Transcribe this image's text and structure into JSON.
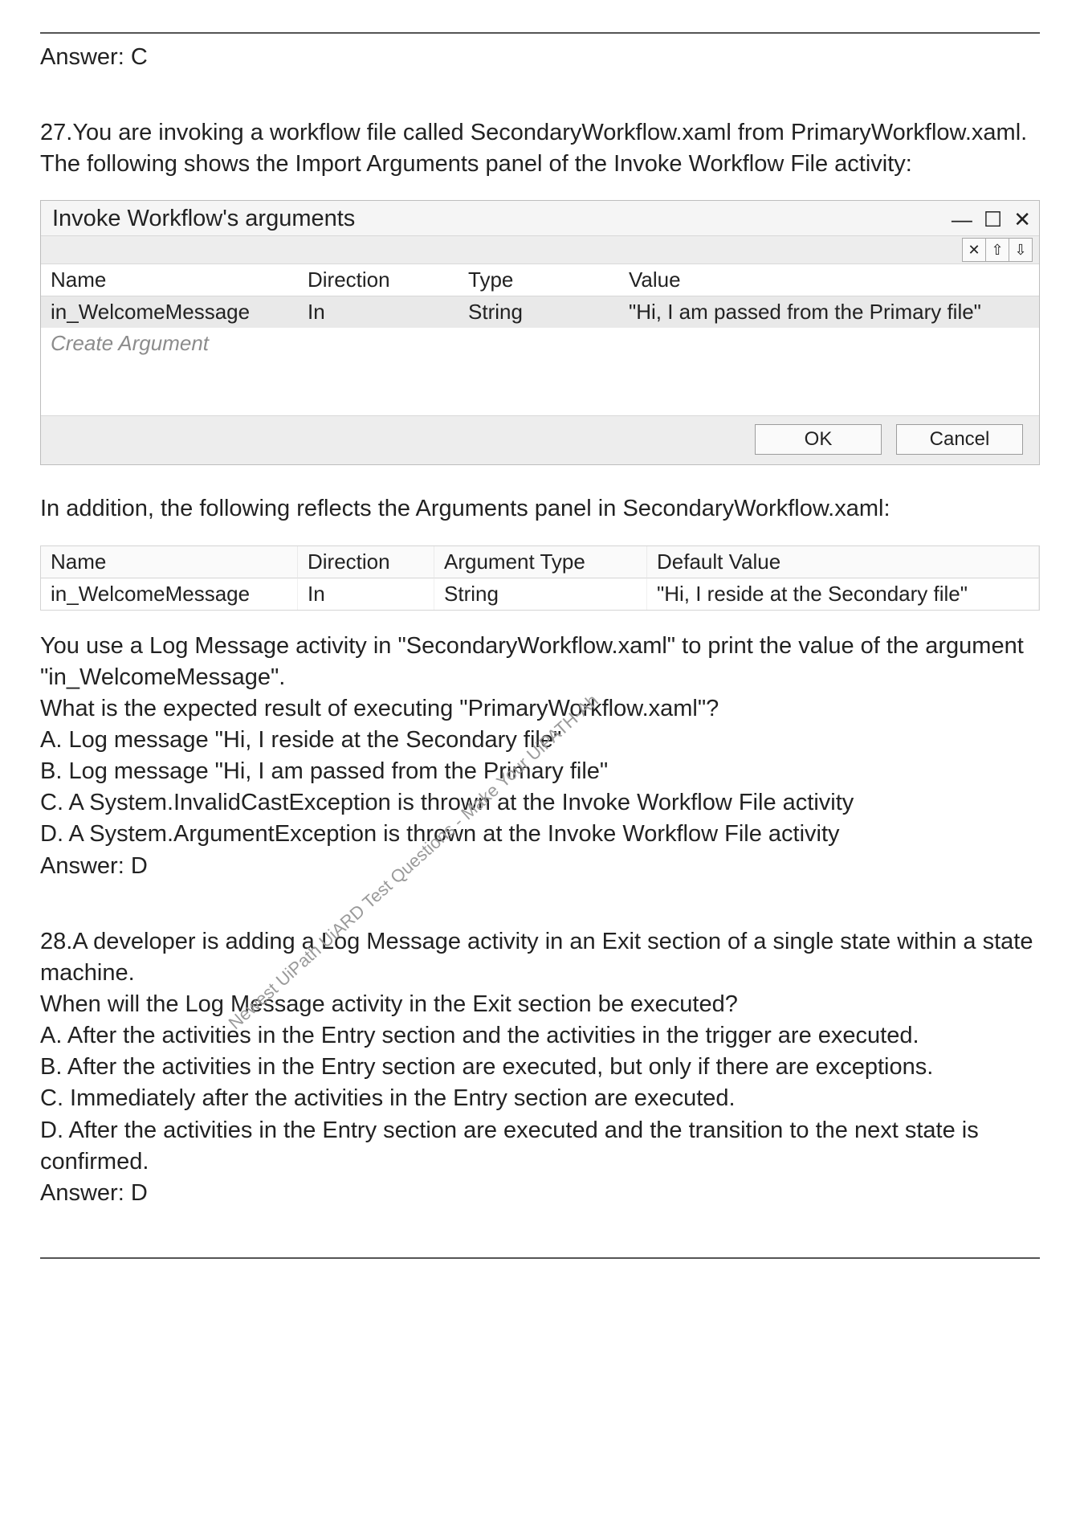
{
  "top_answer": "Answer: C",
  "q27": {
    "intro_line1": "27.You are invoking a workflow file called SecondaryWorkflow.xaml from PrimaryWorkflow.xaml.",
    "intro_line2": "The following shows the Import Arguments panel of the Invoke Workflow File activity:",
    "dialog": {
      "title": "Invoke Workflow's arguments",
      "minimize": "—",
      "maximize": "☐",
      "close": "✕",
      "tool_delete": "✕",
      "tool_up": "⇧",
      "tool_down": "⇩",
      "headers": {
        "name": "Name",
        "direction": "Direction",
        "type": "Type",
        "value": "Value"
      },
      "row": {
        "name": "in_WelcomeMessage",
        "direction": "In",
        "type": "String",
        "value": "\"Hi, I am passed from the Primary file\""
      },
      "create": "Create Argument",
      "ok": "OK",
      "cancel": "Cancel"
    },
    "mid_line": "In addition, the following reflects the Arguments panel in SecondaryWorkflow.xaml:",
    "args_panel": {
      "headers": {
        "name": "Name",
        "direction": "Direction",
        "argtype": "Argument Type",
        "default": "Default Value"
      },
      "row": {
        "name": "in_WelcomeMessage",
        "direction": "In",
        "argtype": "String",
        "default": "\"Hi, I reside at the Secondary file\""
      }
    },
    "post_line1": "You use a Log Message activity in \"SecondaryWorkflow.xaml\" to print the value of the argument \"in_WelcomeMessage\".",
    "post_line2": "What is the expected result of executing \"PrimaryWorkflow.xaml\"?",
    "opt_a": "A. Log message \"Hi, I reside at the Secondary file\"",
    "opt_b": "B. Log message \"Hi, I am passed from the Primary file\"",
    "opt_c": "C. A System.InvalidCastException is thrown at the Invoke Workflow File activity",
    "opt_d": "D. A System.ArgumentException is thrown at the Invoke Workflow File activity",
    "answer": "Answer: D"
  },
  "q28": {
    "intro": "28.A developer is adding a Log Message activity in an Exit section of a single state within a state machine.",
    "q": "When will the Log Message activity in the Exit section be executed?",
    "opt_a": "A. After the activities in the Entry section and the activities in the trigger are executed.",
    "opt_b": "B. After the activities in the Entry section are executed, but only if there are exceptions.",
    "opt_c": "C. Immediately after the activities in the Entry section are executed.",
    "opt_d": "D. After the activities in the Entry section are executed and the transition to the next state is confirmed.",
    "answer": "Answer: D"
  },
  "watermark": "Newest UiPath UiARD Test Questions - Make Your UiPATH-Ah"
}
